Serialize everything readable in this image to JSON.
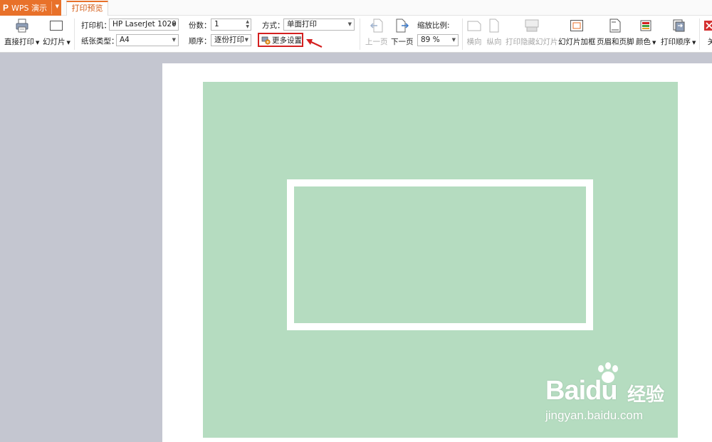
{
  "app": {
    "logo": "P",
    "name": "WPS 演示"
  },
  "tabs": [
    {
      "label": "打印预览",
      "active": true
    }
  ],
  "ribbon": {
    "direct_print": "直接打印",
    "slides": "幻灯片",
    "printer_label": "打印机：",
    "printer_value": "HP LaserJet 1020",
    "paper_label": "纸张类型：",
    "paper_value": "A4",
    "copies_label": "份数：",
    "copies_value": "1",
    "order_label": "顺序：",
    "order_value": "逐份打印",
    "mode_label": "方式：",
    "mode_value": "单面打印",
    "more_settings": "更多设置",
    "prev_page": "上一页",
    "next_page": "下一页",
    "zoom_label": "缩放比例:",
    "zoom_value": "89 %",
    "landscape": "横向",
    "portrait": "纵向",
    "print_hidden": "打印隐藏幻灯片",
    "slide_frame": "幻灯片加框",
    "header_footer": "页眉和页脚",
    "color": "颜色",
    "print_order": "打印顺序",
    "close": "关"
  },
  "watermark": {
    "brand": "Baidu",
    "brand_cn": "经验",
    "url": "jingyan.baidu.com"
  },
  "colors": {
    "accent": "#e8712a",
    "highlight": "#d42020",
    "slide_bg": "#b5dcc0",
    "workspace": "#c4c6d0"
  }
}
